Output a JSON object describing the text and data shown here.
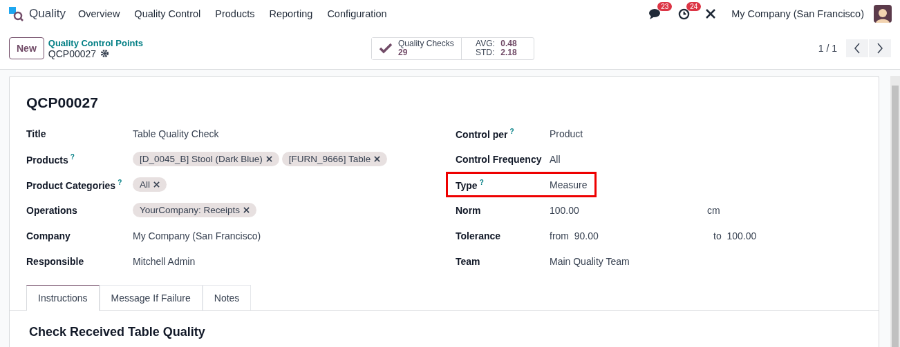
{
  "app": {
    "name": "Quality",
    "menu": [
      "Overview",
      "Quality Control",
      "Products",
      "Reporting",
      "Configuration"
    ]
  },
  "systray": {
    "messages_badge": "23",
    "activities_badge": "24",
    "company": "My Company (San Francisco)"
  },
  "control_panel": {
    "new_button": "New",
    "breadcrumb": "Quality Control Points",
    "record": "QCP00027",
    "stat": {
      "label": "Quality Checks",
      "value": "29",
      "avg_label": "AVG:",
      "avg": "0.48",
      "std_label": "STD:",
      "std": "2.18"
    },
    "pager": "1 / 1"
  },
  "form": {
    "title": "QCP00027",
    "left_fields": [
      {
        "label": "Title",
        "kind": "text",
        "value": "Table Quality Check"
      },
      {
        "label": "Products",
        "help": "?",
        "kind": "tags",
        "tags": [
          "[D_0045_B] Stool (Dark Blue)",
          "[FURN_9666] Table"
        ]
      },
      {
        "label": "Product Categories",
        "help": "?",
        "kind": "tags",
        "tags": [
          "All"
        ]
      },
      {
        "label": "Operations",
        "kind": "tags",
        "tags": [
          "YourCompany: Receipts"
        ]
      },
      {
        "label": "Company",
        "kind": "text",
        "value": "My Company (San Francisco)"
      },
      {
        "label": "Responsible",
        "kind": "text",
        "value": "Mitchell Admin"
      }
    ],
    "right_fields": [
      {
        "label": "Control per",
        "help": "?",
        "kind": "text",
        "value": "Product",
        "highlighted": false
      },
      {
        "label": "Control Frequency",
        "kind": "text",
        "value": "All",
        "highlighted": false
      },
      {
        "label": "Type",
        "help": "?",
        "kind": "text",
        "value": "Measure",
        "highlighted": true
      },
      {
        "label": "Norm",
        "kind": "unit",
        "value": "100.00",
        "unit": "cm",
        "highlighted": false
      },
      {
        "label": "Tolerance",
        "kind": "range",
        "from_label": "from",
        "from": "90.00",
        "to_label": "to",
        "to": "100.00",
        "highlighted": false
      },
      {
        "label": "Team",
        "kind": "text",
        "value": "Main Quality Team",
        "highlighted": false
      }
    ],
    "tabs": [
      {
        "label": "Instructions",
        "selected": true
      },
      {
        "label": "Message If Failure",
        "selected": false
      },
      {
        "label": "Notes",
        "selected": false
      }
    ],
    "tab_heading": "Check Received Table Quality"
  }
}
